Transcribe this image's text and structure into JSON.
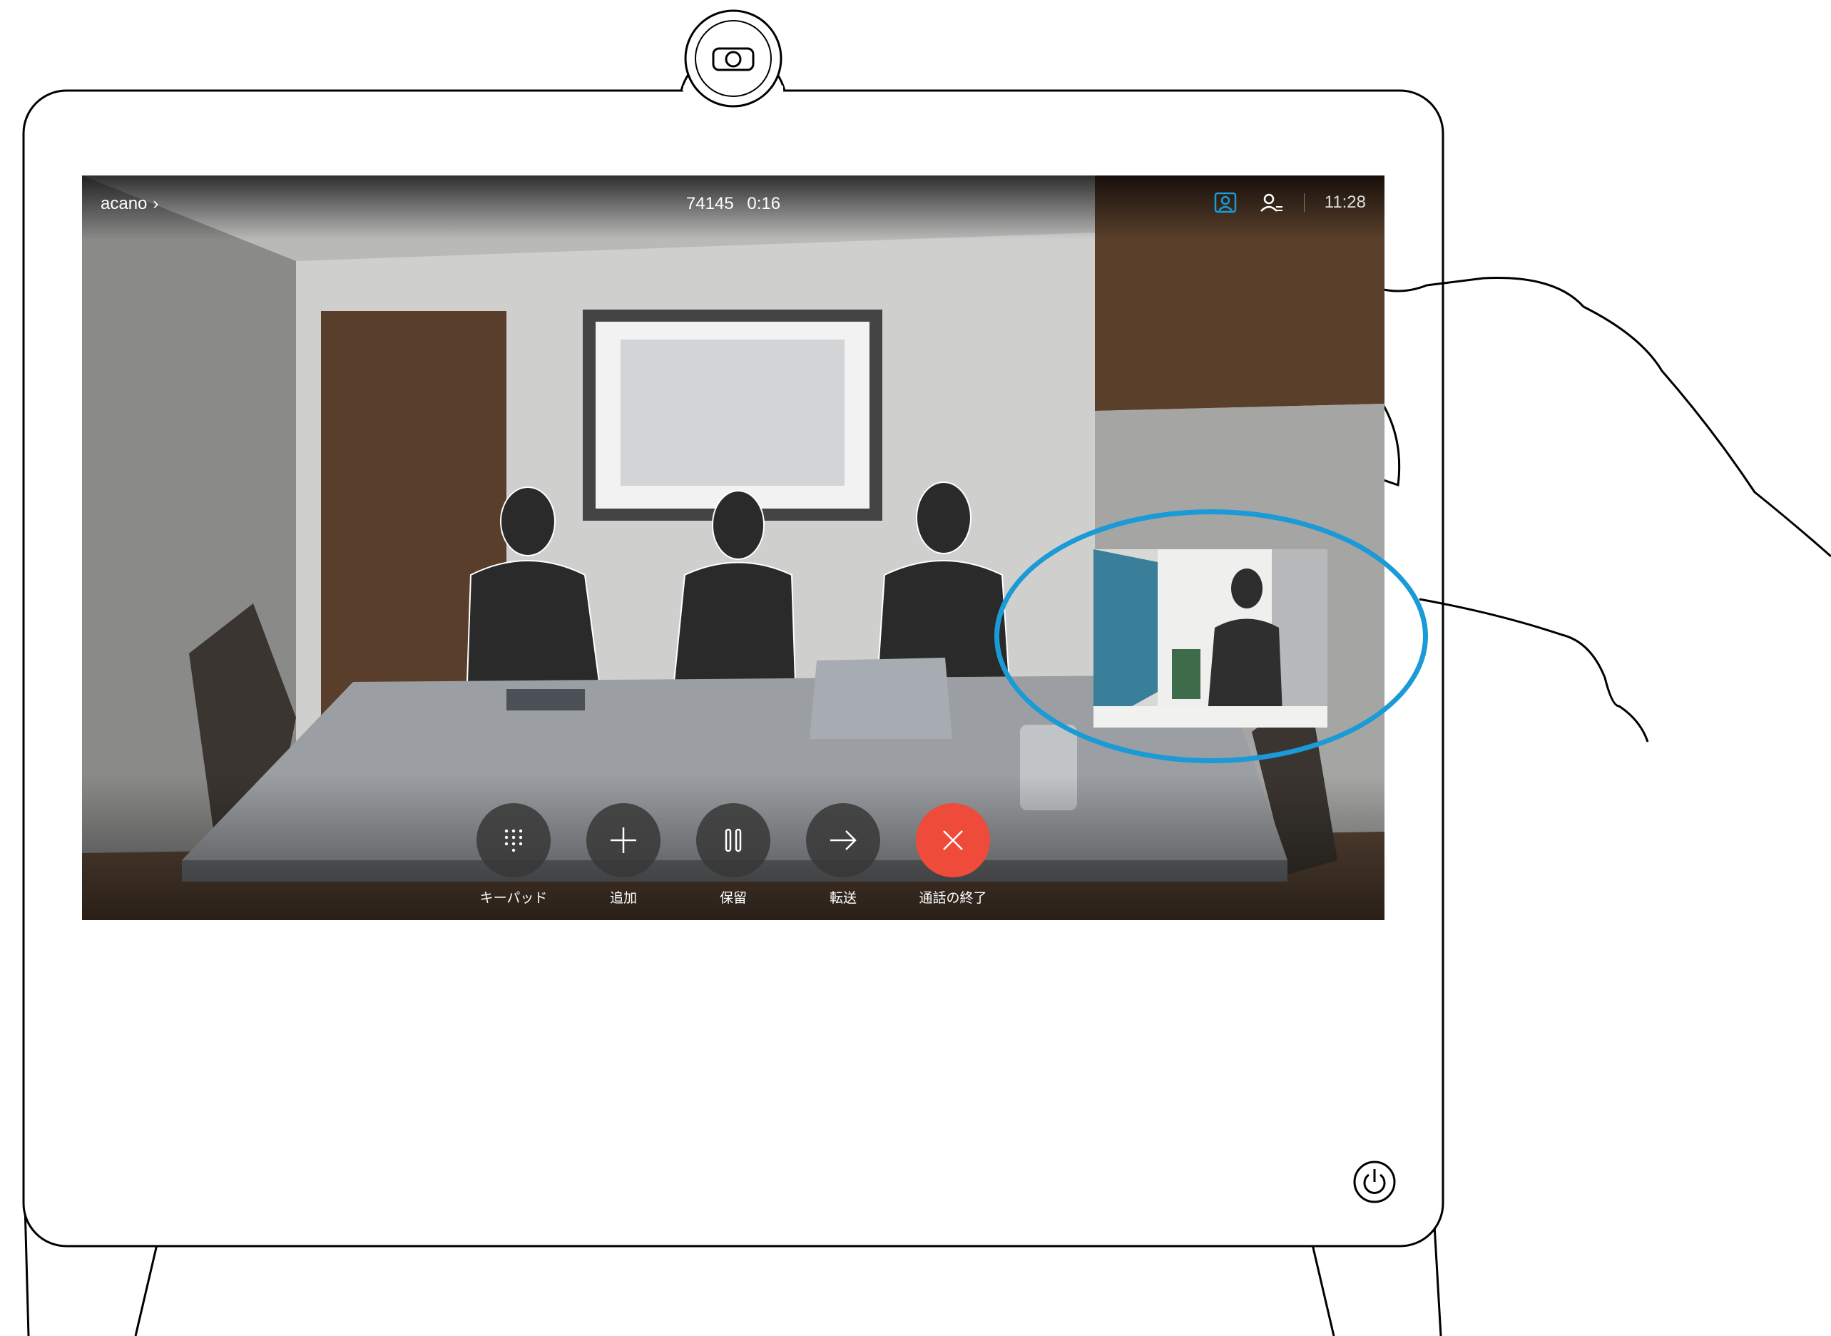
{
  "header": {
    "caller_name": "acano",
    "call_number": "74145",
    "call_duration": "0:16",
    "time": "11:28"
  },
  "icons": {
    "selfview_toggle": "person-frame-icon",
    "participants": "person-list-icon",
    "caller_chevron": "chevron-right-icon",
    "camera": "camera-icon",
    "power": "power-icon"
  },
  "controls": [
    {
      "label": "キーパッド",
      "icon": "keypad-icon"
    },
    {
      "label": "追加",
      "icon": "plus-icon"
    },
    {
      "label": "保留",
      "icon": "pause-icon"
    },
    {
      "label": "転送",
      "icon": "arrow-right-icon"
    },
    {
      "label": "通話の終了",
      "icon": "close-icon"
    }
  ],
  "colors": {
    "highlight": "#1a9ad6",
    "end_call": "#ee4b3a",
    "selfview_active": "#1a9ad6"
  }
}
